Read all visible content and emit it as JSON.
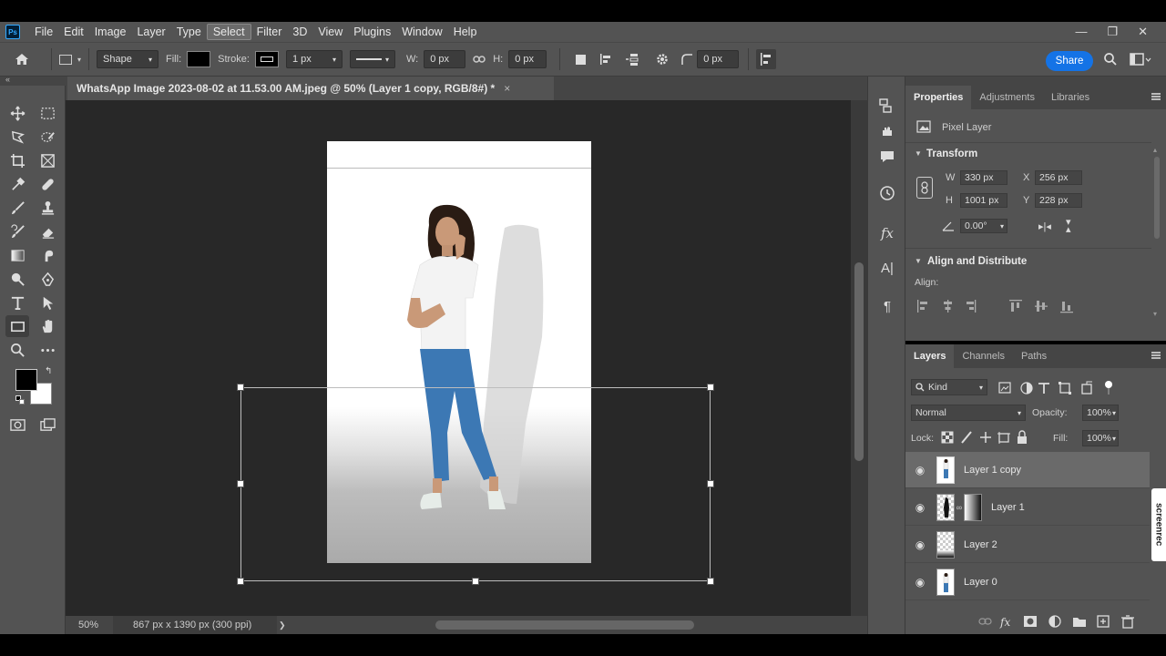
{
  "menubar": {
    "app_badge": "Ps",
    "items": [
      "File",
      "Edit",
      "Image",
      "Layer",
      "Type",
      "Select",
      "Filter",
      "3D",
      "View",
      "Plugins",
      "Window",
      "Help"
    ],
    "active_item": "Select",
    "window_controls": [
      "—",
      "❐",
      "✕"
    ]
  },
  "options_bar": {
    "mode": "Shape",
    "fill_label": "Fill:",
    "stroke_label": "Stroke:",
    "stroke_width": "1 px",
    "w_label": "W:",
    "w_value": "0 px",
    "h_label": "H:",
    "h_value": "0 px",
    "corner_radius": "0 px",
    "share_label": "Share"
  },
  "document": {
    "tab_title": "WhatsApp Image 2023-08-02 at 11.53.00 AM.jpeg @ 50% (Layer 1 copy, RGB/8#) *",
    "close": "×"
  },
  "status": {
    "zoom": "50%",
    "info": "867 px x 1390 px (300 ppi)",
    "arrow": "❯"
  },
  "properties": {
    "tabs": [
      "Properties",
      "Adjustments",
      "Libraries"
    ],
    "active_tab": "Properties",
    "layer_type": "Pixel Layer",
    "transform_title": "Transform",
    "w_label": "W",
    "w_value": "330 px",
    "h_label": "H",
    "h_value": "1001 px",
    "x_label": "X",
    "x_value": "256 px",
    "y_label": "Y",
    "y_value": "228 px",
    "angle": "0.00°",
    "align_title": "Align and Distribute",
    "align_label": "Align:"
  },
  "layers": {
    "tabs": [
      "Layers",
      "Channels",
      "Paths"
    ],
    "active_tab": "Layers",
    "filter_kind": "Kind",
    "blend_mode": "Normal",
    "opacity_label": "Opacity:",
    "opacity": "100%",
    "lock_label": "Lock:",
    "fill_label": "Fill:",
    "fill": "100%",
    "items": [
      {
        "name": "Layer 1 copy",
        "selected": true
      },
      {
        "name": "Layer 1",
        "selected": false
      },
      {
        "name": "Layer 2",
        "selected": false
      },
      {
        "name": "Layer 0",
        "selected": false
      }
    ]
  },
  "overlay": {
    "screenrec": "screenrec"
  },
  "colors": {
    "accent": "#1473e6",
    "panel_bg": "#535353",
    "canvas_bg": "#282828"
  }
}
